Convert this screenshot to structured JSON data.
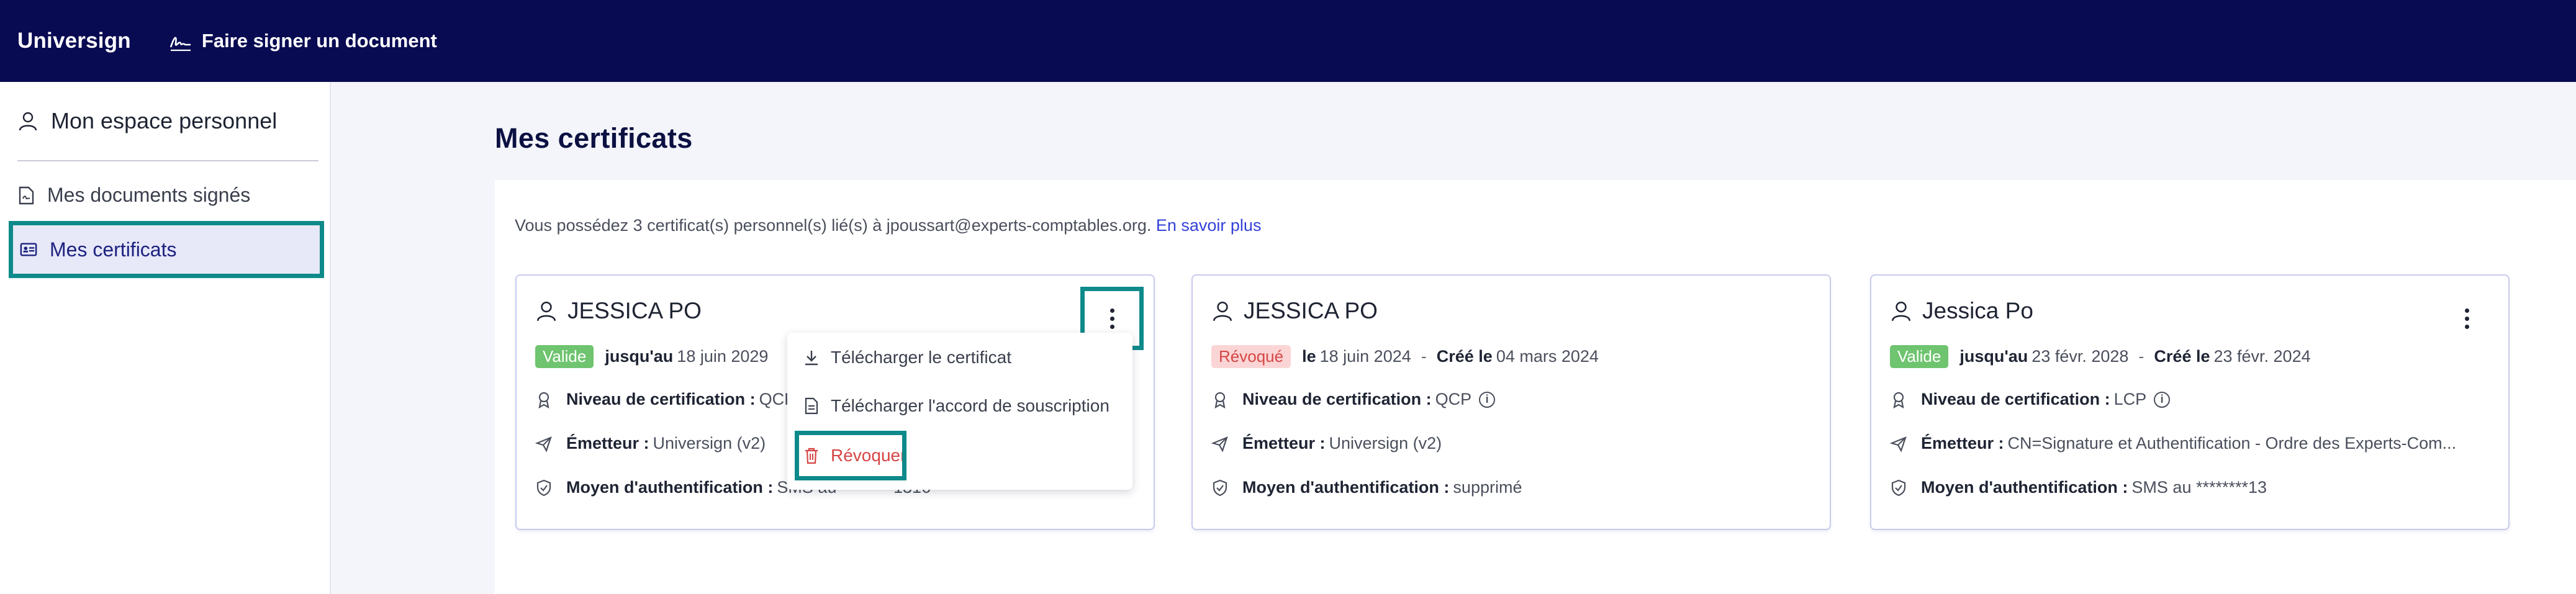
{
  "topbar": {
    "brand": "Universign",
    "sign_document_label": "Faire signer un document"
  },
  "sidebar": {
    "header": "Mon espace personnel",
    "items": [
      {
        "label": "Mes documents signés"
      },
      {
        "label": "Mes certificats"
      }
    ]
  },
  "main": {
    "title": "Mes certificats",
    "info_text": "Vous possédez 3 certificat(s) personnel(s) lié(s) à jpoussart@experts-comptables.org.",
    "learn_more": "En savoir plus"
  },
  "labels": {
    "until": "jusqu'au",
    "on": "le",
    "created_on": "Créé le",
    "level": "Niveau de certification :",
    "issuer": "Émetteur :",
    "auth": "Moyen d'authentification :",
    "sep": "-"
  },
  "cards": [
    {
      "name": "JESSICA PO",
      "status": "Valide",
      "date": "18 juin 2029",
      "level": "QCP",
      "issuer": "Universign (v2)",
      "auth": "SMS au ********1316"
    },
    {
      "name": "JESSICA PO",
      "status": "Révoqué",
      "date": "18 juin 2024",
      "created": "04 mars 2024",
      "level": "QCP",
      "issuer": "Universign (v2)",
      "auth": "supprimé"
    },
    {
      "name": "Jessica Po",
      "status": "Valide",
      "date": "23 févr. 2028",
      "created": "23 févr. 2024",
      "level": "LCP",
      "issuer": "CN=Signature et Authentification - Ordre des Experts-Com...",
      "auth": "SMS au ********13"
    }
  ],
  "menu": {
    "download_cert": "Télécharger le certificat",
    "download_agreement": "Télécharger l'accord de souscription",
    "revoke": "Révoquer"
  },
  "colors": {
    "topbar": "#080a52",
    "highlight": "#0e8a8a",
    "valid": "#6fc46f",
    "revoked": "#d64545",
    "link": "#3341d8"
  }
}
